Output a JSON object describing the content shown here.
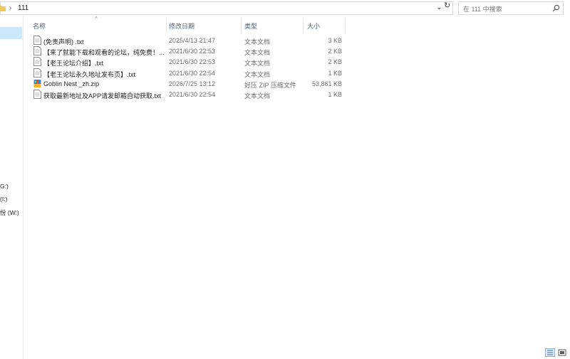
{
  "address": {
    "crumb": "111"
  },
  "search": {
    "placeholder": "在 111 中搜索"
  },
  "nav": {
    "items": [
      "G:)",
      "(I:)",
      "份 (W:)"
    ]
  },
  "columns": {
    "name": "名称",
    "date": "修改日期",
    "type": "类型",
    "size": "大小"
  },
  "files": [
    {
      "name": "(免责声明) .txt",
      "date": "2025/4/13 21:47",
      "type": "文本文档",
      "size": "3 KB",
      "icon": "text-file-icon"
    },
    {
      "name": "【来了就能下载和观看的论坛，纯免费！...",
      "date": "2021/6/30 22:53",
      "type": "文本文档",
      "size": "2 KB",
      "icon": "text-file-icon"
    },
    {
      "name": "【老王论坛介绍】.txt",
      "date": "2021/6/30 22:53",
      "type": "文本文档",
      "size": "2 KB",
      "icon": "text-file-icon"
    },
    {
      "name": "【老王论坛永久地址发布页】.txt",
      "date": "2021/6/30 22:54",
      "type": "文本文档",
      "size": "1 KB",
      "icon": "text-file-icon"
    },
    {
      "name": "Goblin Nest _zh.zip",
      "date": "2026/7/25 13:12",
      "type": "好压 ZIP 压缩文件",
      "size": "53,861 KB",
      "icon": "zip-archive-icon"
    },
    {
      "name": "获取最新地址及APP请发邮箱自动获取.txt",
      "date": "2021/6/30 22:54",
      "type": "文本文档",
      "size": "1 KB",
      "icon": "text-file-icon"
    }
  ]
}
